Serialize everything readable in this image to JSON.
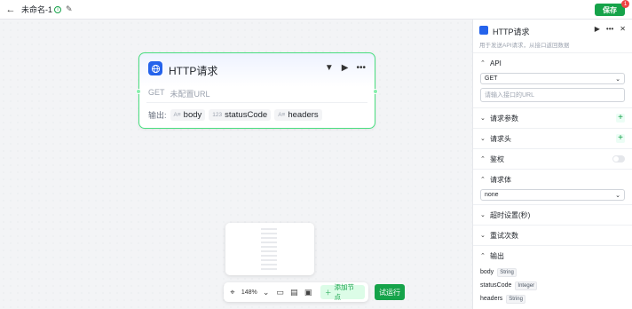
{
  "topbar": {
    "title": "未命名-1",
    "save_label": "保存",
    "save_badge": "1"
  },
  "node": {
    "title": "HTTP请求",
    "method": "GET",
    "url_placeholder": "未配置URL",
    "outputs_label": "输出:",
    "outputs": [
      {
        "type": "A≡",
        "name": "body"
      },
      {
        "type": "123",
        "name": "statusCode"
      },
      {
        "type": "A≡",
        "name": "headers"
      }
    ]
  },
  "toolbar": {
    "zoom": "148%",
    "add_node_label": "添加节点",
    "run_label": "试运行"
  },
  "panel": {
    "title": "HTTP请求",
    "description": "用于发送API请求，从接口返回数据",
    "api": {
      "label": "API",
      "method": "GET",
      "url_placeholder": "请输入接口的URL"
    },
    "params_label": "请求参数",
    "headers_label": "请求头",
    "auth_label": "鉴权",
    "body": {
      "label": "请求体",
      "value": "none"
    },
    "timeout_label": "超时设置(秒)",
    "retry_label": "重试次数",
    "output": {
      "label": "输出",
      "fields": [
        {
          "name": "body",
          "type": "String"
        },
        {
          "name": "statusCode",
          "type": "Integer"
        },
        {
          "name": "headers",
          "type": "String"
        }
      ]
    }
  },
  "colors": {
    "accent": "#16a34a",
    "node_border": "#4ade80",
    "icon_blue": "#2563eb",
    "badge": "#ef4444"
  }
}
